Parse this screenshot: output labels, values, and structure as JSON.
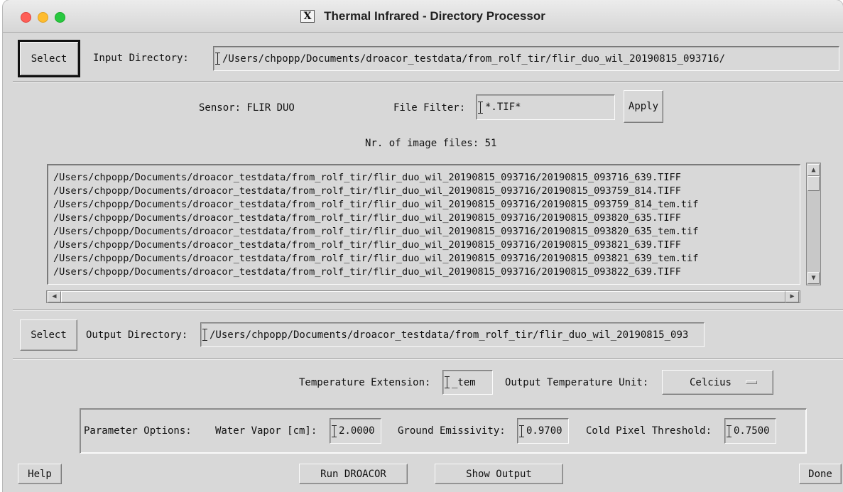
{
  "window": {
    "title": "Thermal Infrared - Directory Processor",
    "x_badge": "X"
  },
  "input": {
    "select_label": "Select",
    "dir_label": "Input Directory:",
    "dir_value": "/Users/chpopp/Documents/droacor_testdata/from_rolf_tir/flir_duo_wil_20190815_093716/"
  },
  "sensor": {
    "text": "Sensor: FLIR DUO"
  },
  "filter": {
    "label": "File Filter:",
    "value": "*.TIF*",
    "apply_label": "Apply"
  },
  "count": {
    "text": "Nr. of image files: 51"
  },
  "files": [
    "/Users/chpopp/Documents/droacor_testdata/from_rolf_tir/flir_duo_wil_20190815_093716/20190815_093716_639.TIFF",
    "/Users/chpopp/Documents/droacor_testdata/from_rolf_tir/flir_duo_wil_20190815_093716/20190815_093759_814.TIFF",
    "/Users/chpopp/Documents/droacor_testdata/from_rolf_tir/flir_duo_wil_20190815_093716/20190815_093759_814_tem.tif",
    "/Users/chpopp/Documents/droacor_testdata/from_rolf_tir/flir_duo_wil_20190815_093716/20190815_093820_635.TIFF",
    "/Users/chpopp/Documents/droacor_testdata/from_rolf_tir/flir_duo_wil_20190815_093716/20190815_093820_635_tem.tif",
    "/Users/chpopp/Documents/droacor_testdata/from_rolf_tir/flir_duo_wil_20190815_093716/20190815_093821_639.TIFF",
    "/Users/chpopp/Documents/droacor_testdata/from_rolf_tir/flir_duo_wil_20190815_093716/20190815_093821_639_tem.tif",
    "/Users/chpopp/Documents/droacor_testdata/from_rolf_tir/flir_duo_wil_20190815_093716/20190815_093822_639.TIFF"
  ],
  "output": {
    "select_label": "Select",
    "dir_label": "Output Directory:",
    "dir_value": "/Users/chpopp/Documents/droacor_testdata/from_rolf_tir/flir_duo_wil_20190815_093"
  },
  "temperature": {
    "ext_label": "Temperature Extension:",
    "ext_value": "_tem",
    "unit_label": "Output Temperature Unit:",
    "unit_value": "Celcius"
  },
  "params": {
    "title": "Parameter Options:",
    "water_vapor_label": "Water Vapor [cm]:",
    "water_vapor_value": "2.0000",
    "emissivity_label": "Ground Emissivity:",
    "emissivity_value": "0.9700",
    "cold_pixel_label": "Cold Pixel Threshold:",
    "cold_pixel_value": "0.7500"
  },
  "buttons": {
    "help": "Help",
    "run": "Run DROACOR",
    "show_output": "Show Output",
    "done": "Done"
  }
}
